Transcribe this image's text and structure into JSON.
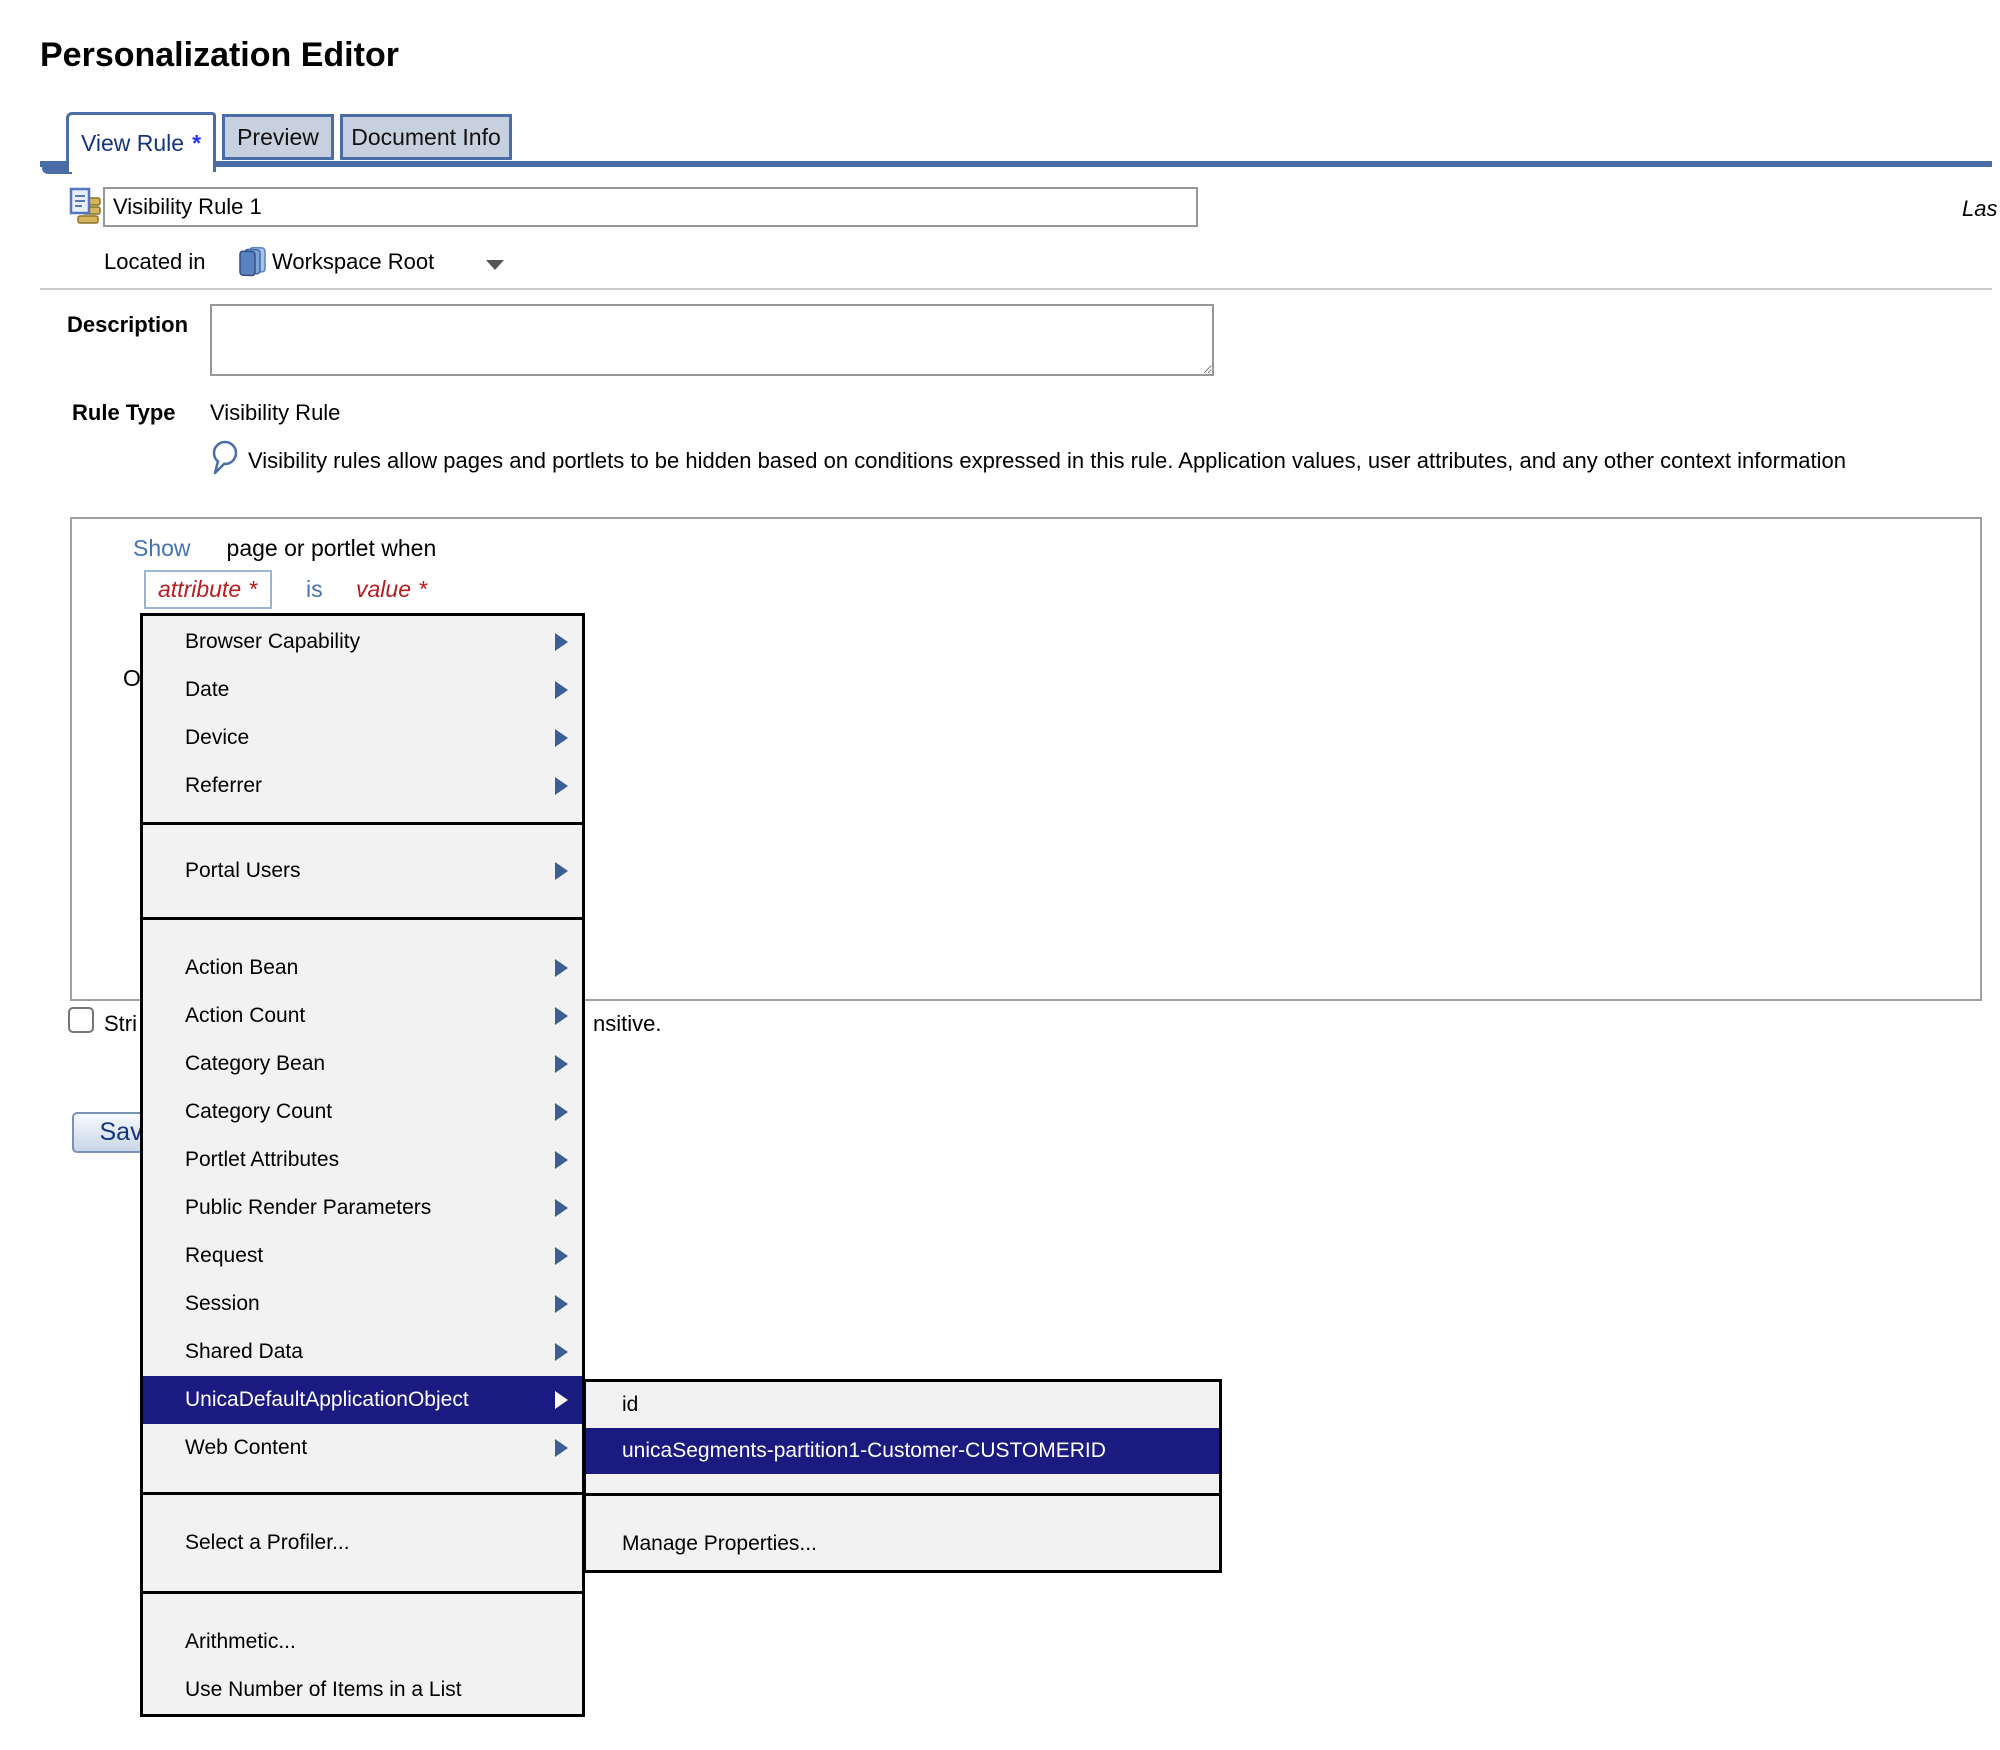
{
  "colors": {
    "accent_blue": "#4a6da7",
    "inactive_tab_bg": "#c7d0de",
    "navy_text": "#16357e",
    "link_blue": "#4472b4",
    "required_red": "#b51f1f",
    "tab_asterisk_blue": "#2233ee",
    "menu_bg": "#f2f2f2",
    "menu_highlight": "#1a1a80",
    "arrow_blue": "#3b5e95"
  },
  "page": {
    "title": "Personalization Editor"
  },
  "tabs": [
    {
      "label": "View Rule",
      "marker": "*",
      "active": true
    },
    {
      "label": "Preview",
      "active": false
    },
    {
      "label": "Document Info",
      "active": false
    }
  ],
  "name_field": {
    "value": "Visibility Rule 1"
  },
  "located_in": {
    "label": "Located in",
    "value": "Workspace Root"
  },
  "top_right_clipped_text": "Las",
  "description": {
    "label": "Description",
    "value": ""
  },
  "rule_type": {
    "label": "Rule Type",
    "value": "Visibility Rule"
  },
  "help_text": "Visibility rules allow pages and portlets to be hidden based on conditions expressed in this rule. Application values, user attributes, and any other context information",
  "rule_editor": {
    "action_link": "Show",
    "action_suffix": "page or portlet when",
    "attribute_token": "attribute",
    "attribute_required": "*",
    "operator_link": "is",
    "value_token": "value",
    "value_required": "*",
    "clipped_fragment": "O"
  },
  "case_sensitivity_row": {
    "checked": false,
    "fragment_left": "Stri",
    "fragment_right": "nsitive."
  },
  "save_button": {
    "label": "Save"
  },
  "attribute_menu": {
    "groups": [
      {
        "items": [
          {
            "label": "Browser Capability"
          },
          {
            "label": "Date"
          },
          {
            "label": "Device"
          },
          {
            "label": "Referrer"
          }
        ]
      },
      {
        "items": [
          {
            "label": "Portal Users"
          }
        ]
      },
      {
        "items": [
          {
            "label": "Action Bean"
          },
          {
            "label": "Action Count"
          },
          {
            "label": "Category Bean"
          },
          {
            "label": "Category Count"
          },
          {
            "label": "Portlet Attributes"
          },
          {
            "label": "Public Render Parameters"
          },
          {
            "label": "Request"
          },
          {
            "label": "Session"
          },
          {
            "label": "Shared Data"
          },
          {
            "label": "UnicaDefaultApplicationObject",
            "highlighted": true
          },
          {
            "label": "Web Content"
          }
        ]
      },
      {
        "items": [
          {
            "label": "Select a Profiler..."
          }
        ]
      },
      {
        "items": [
          {
            "label": "Arithmetic..."
          },
          {
            "label": "Use Number of Items in a List"
          }
        ]
      }
    ]
  },
  "unica_submenu": {
    "items": [
      {
        "label": "id"
      },
      {
        "label": "unicaSegments-partition1-Customer-CUSTOMERID",
        "highlighted": true
      }
    ],
    "footer_item": {
      "label": "Manage Properties..."
    }
  }
}
